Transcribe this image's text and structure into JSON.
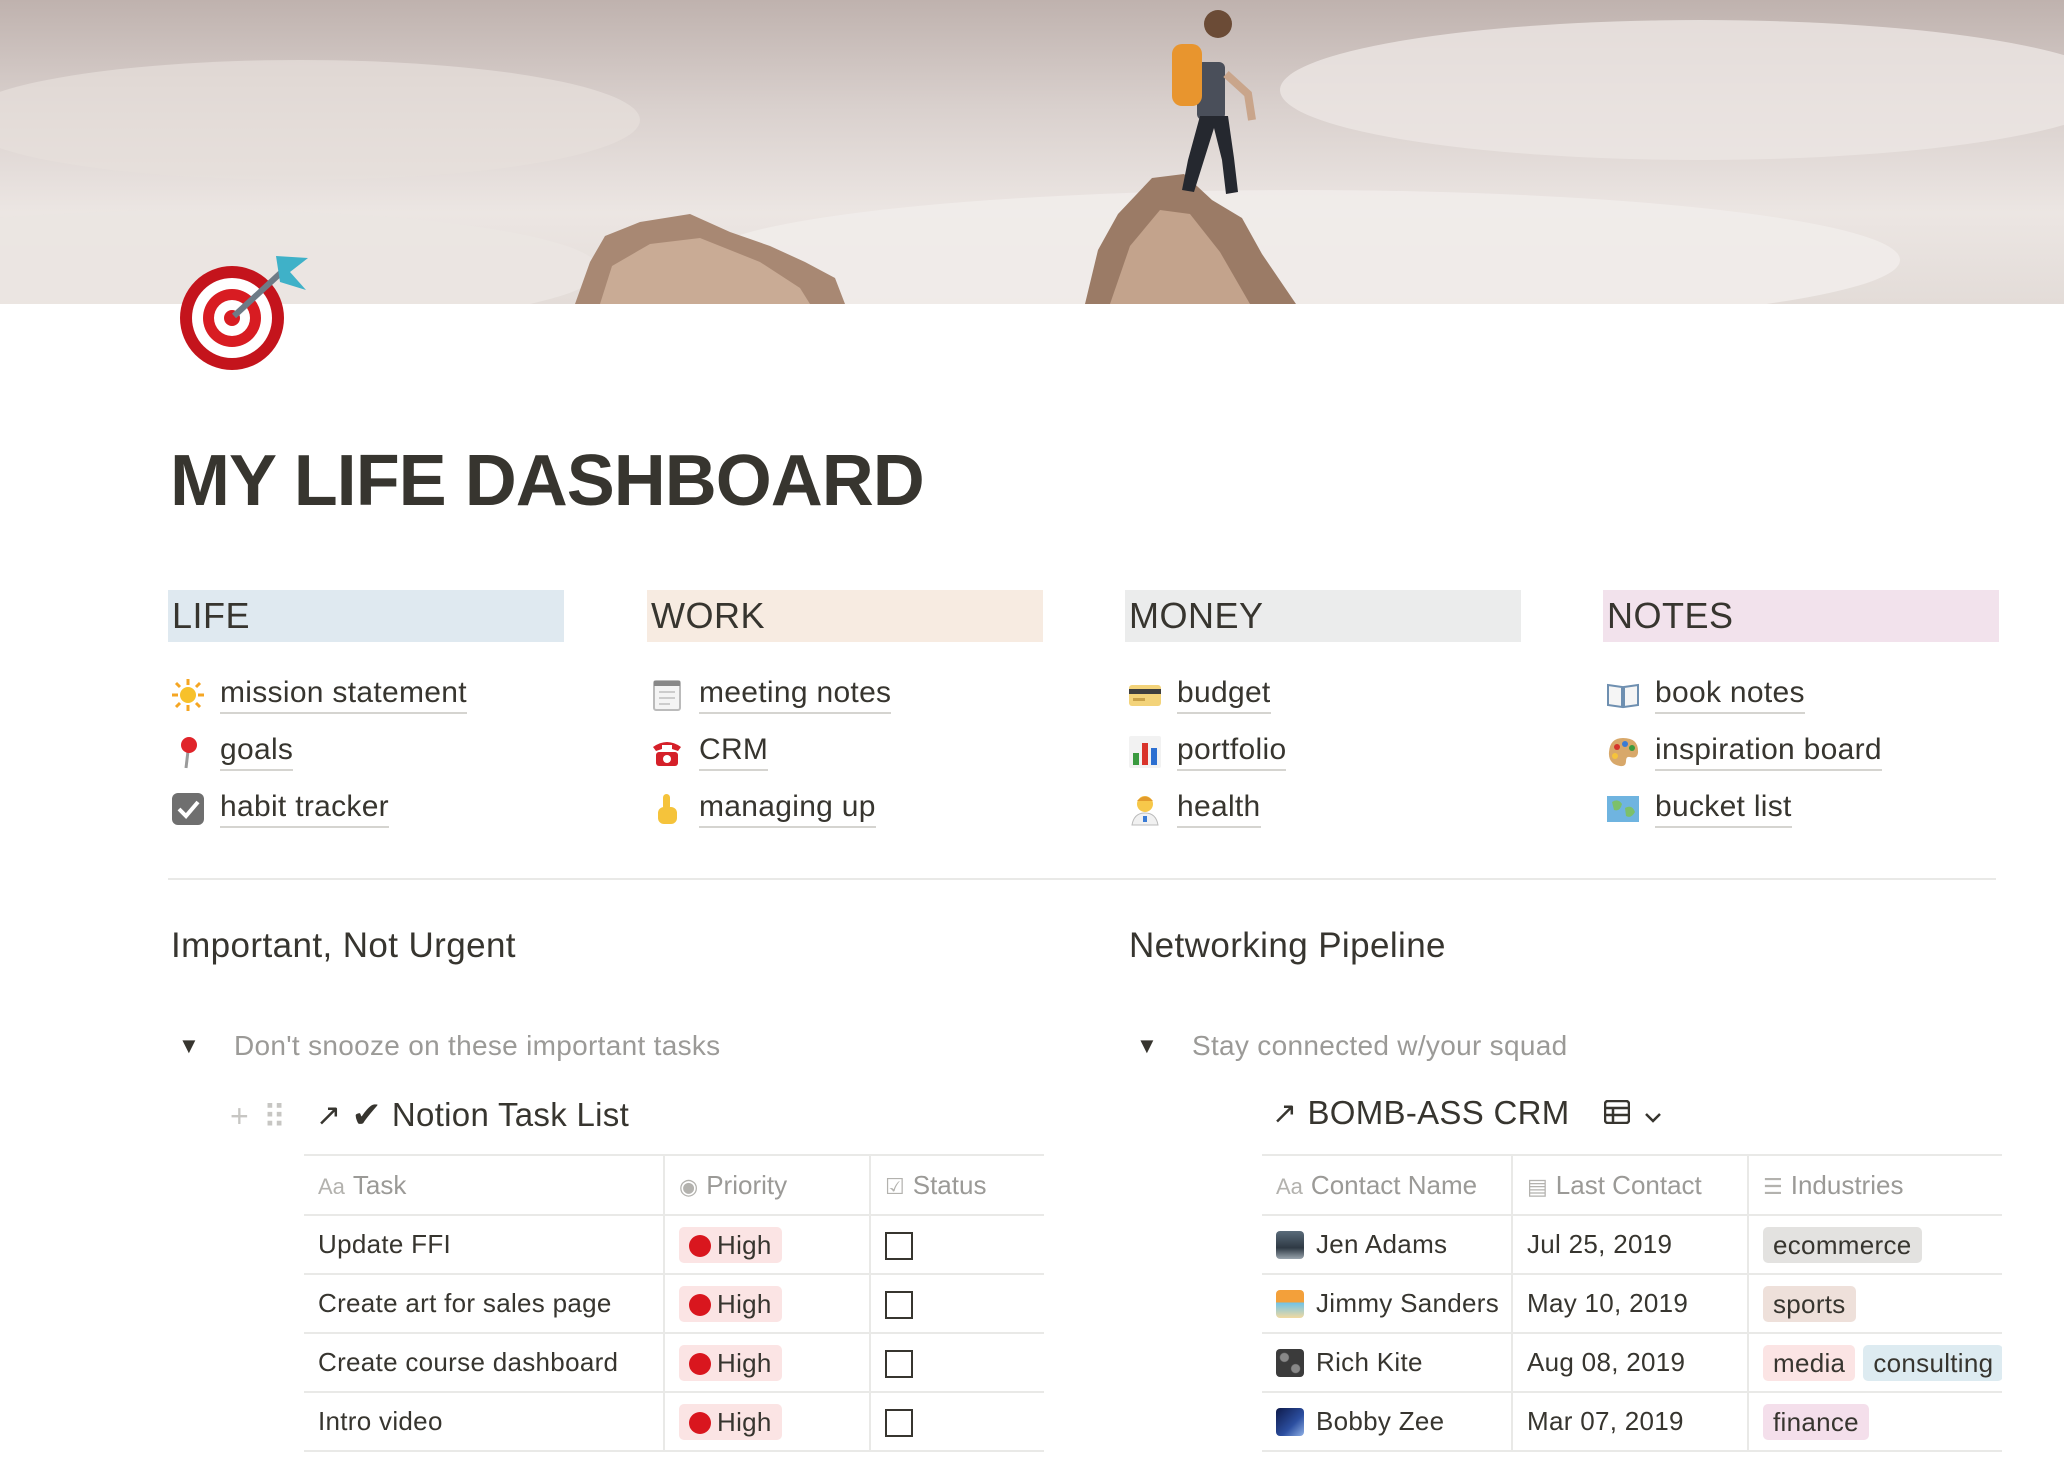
{
  "page": {
    "title": "MY LIFE DASHBOARD",
    "icon": "direct-hit-target-icon",
    "cover": "hiker-on-rock-cover-image"
  },
  "columns": [
    {
      "header": "LIFE",
      "color": "#dfe9f0",
      "links": [
        {
          "label": "mission statement",
          "icon": "sun-icon"
        },
        {
          "label": "goals",
          "icon": "pin-icon"
        },
        {
          "label": "habit tracker",
          "icon": "checkbox-icon"
        }
      ]
    },
    {
      "header": "WORK",
      "color": "#f7ebe1",
      "links": [
        {
          "label": "meeting notes",
          "icon": "notepad-icon"
        },
        {
          "label": "CRM",
          "icon": "telephone-icon"
        },
        {
          "label": "managing up",
          "icon": "pointing-up-icon"
        }
      ]
    },
    {
      "header": "MONEY",
      "color": "#ebecec",
      "links": [
        {
          "label": "budget",
          "icon": "credit-card-icon"
        },
        {
          "label": "portfolio",
          "icon": "bar-chart-icon"
        },
        {
          "label": "health",
          "icon": "health-worker-icon"
        }
      ]
    },
    {
      "header": "NOTES",
      "color": "#f2e2ec",
      "links": [
        {
          "label": "book notes",
          "icon": "open-book-icon"
        },
        {
          "label": "inspiration board",
          "icon": "palette-icon"
        },
        {
          "label": "bucket list",
          "icon": "map-icon"
        }
      ]
    }
  ],
  "important": {
    "title": "Important, Not Urgent",
    "toggle": "Don't snooze on these important tasks",
    "db_title": "Notion Task List",
    "headers": [
      "Task",
      "Priority",
      "Status"
    ],
    "rows": [
      {
        "task": "Update FFI",
        "priority": "High",
        "done": false
      },
      {
        "task": "Create art for sales page",
        "priority": "High",
        "done": false
      },
      {
        "task": "Create course dashboard",
        "priority": "High",
        "done": false
      },
      {
        "task": "Intro video",
        "priority": "High",
        "done": false
      }
    ]
  },
  "networking": {
    "title": "Networking Pipeline",
    "toggle": "Stay connected w/your squad",
    "db_title": "BOMB-ASS CRM",
    "headers": [
      "Contact Name",
      "Last Contact",
      "Industries"
    ],
    "rows": [
      {
        "name": "Jen Adams",
        "icon": "train-icon",
        "date": "Jul 25, 2019",
        "tags": [
          {
            "label": "ecommerce",
            "color": "#e3e2e0"
          }
        ]
      },
      {
        "name": "Jimmy Sanders",
        "icon": "beach-icon",
        "date": "May 10, 2019",
        "tags": [
          {
            "label": "sports",
            "color": "#eee0da"
          }
        ]
      },
      {
        "name": "Rich Kite",
        "icon": "control-knobs-icon",
        "date": "Aug 08, 2019",
        "tags": [
          {
            "label": "media",
            "color": "#fbe4e4"
          },
          {
            "label": "consulting",
            "color": "#ddebf1"
          }
        ]
      },
      {
        "name": "Bobby Zee",
        "icon": "night-sky-icon",
        "date": "Mar 07, 2019",
        "tags": [
          {
            "label": "finance",
            "color": "#f4dfeb"
          }
        ]
      }
    ]
  }
}
